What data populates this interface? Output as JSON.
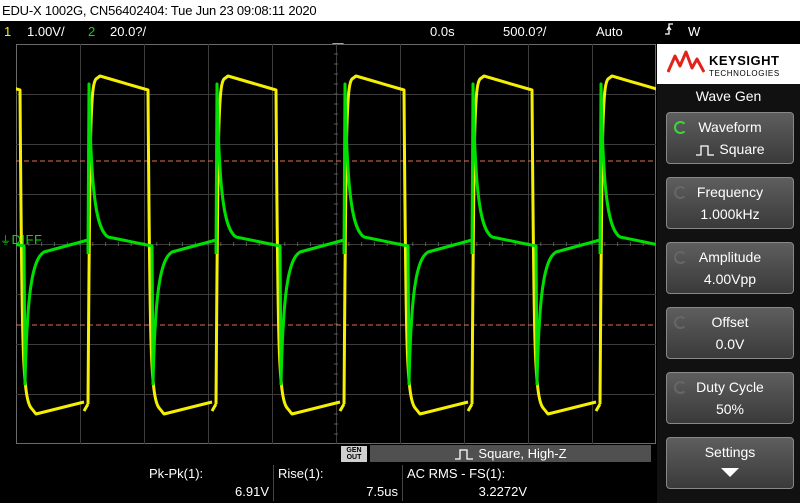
{
  "title_bar": {
    "text": "EDU-X 1002G, CN56402404: Tue Jun 23 09:08:11 2020"
  },
  "status": {
    "ch1_num": "1",
    "ch1_scale": "1.00V/",
    "ch2_num": "2",
    "ch2_scale": "20.0?/",
    "time_offset": "0.0s",
    "time_scale": "500.0?/",
    "trigger_mode": "Auto",
    "trigger_source": "W"
  },
  "waveform": {
    "diff_label": "DIFF",
    "ch1_color": "#f5f000",
    "ch2_color": "#00e000",
    "cursor_color": "#e0704a"
  },
  "gen_out": {
    "tag_line1": "GEN",
    "tag_line2": "OUT",
    "info": "Square, High-Z"
  },
  "measurements": [
    {
      "label": "Pk-Pk(1):",
      "value": "6.91V"
    },
    {
      "label": "Rise(1):",
      "value": "7.5us"
    },
    {
      "label": "AC RMS - FS(1):",
      "value": "3.2272V"
    }
  ],
  "side_panel": {
    "brand": "KEYSIGHT",
    "brand_sub": "TECHNOLOGIES",
    "menu_title": "Wave Gen",
    "softkeys": [
      {
        "label": "Waveform",
        "value": "Square",
        "icon": "square-wave-icon"
      },
      {
        "label": "Frequency",
        "value": "1.000kHz"
      },
      {
        "label": "Amplitude",
        "value": "4.00Vpp"
      },
      {
        "label": "Offset",
        "value": "0.0V"
      },
      {
        "label": "Duty Cycle",
        "value": "50%"
      },
      {
        "label": "Settings",
        "value": ""
      }
    ]
  }
}
